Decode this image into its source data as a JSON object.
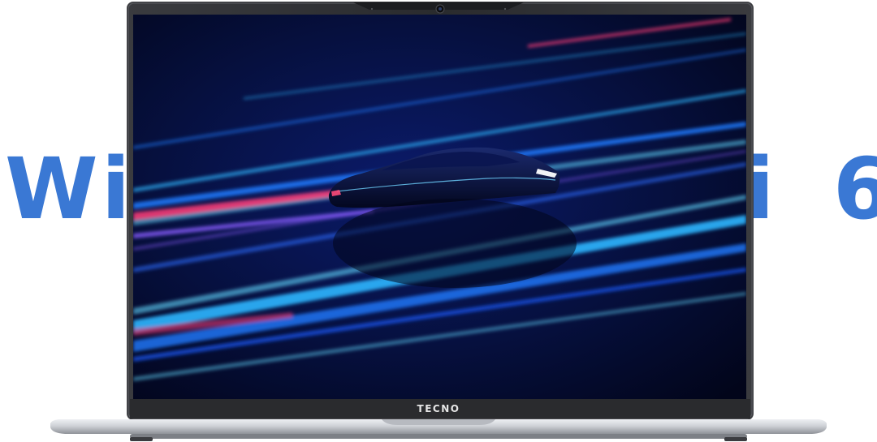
{
  "headline": {
    "left_text": "Wi",
    "right_text": "i 6",
    "color": "#3a78d4"
  },
  "device": {
    "brand": "TECNO",
    "frame_color": "#2a2b2e",
    "base_color": "#c9ccd1"
  },
  "screen": {
    "background_color": "#050a2a",
    "streak_colors": [
      "#1e7bff",
      "#2fb6ff",
      "#ff3c78",
      "#8a5cff",
      "#63d9ff"
    ]
  },
  "icons": {
    "camera": "webcam-icon"
  }
}
